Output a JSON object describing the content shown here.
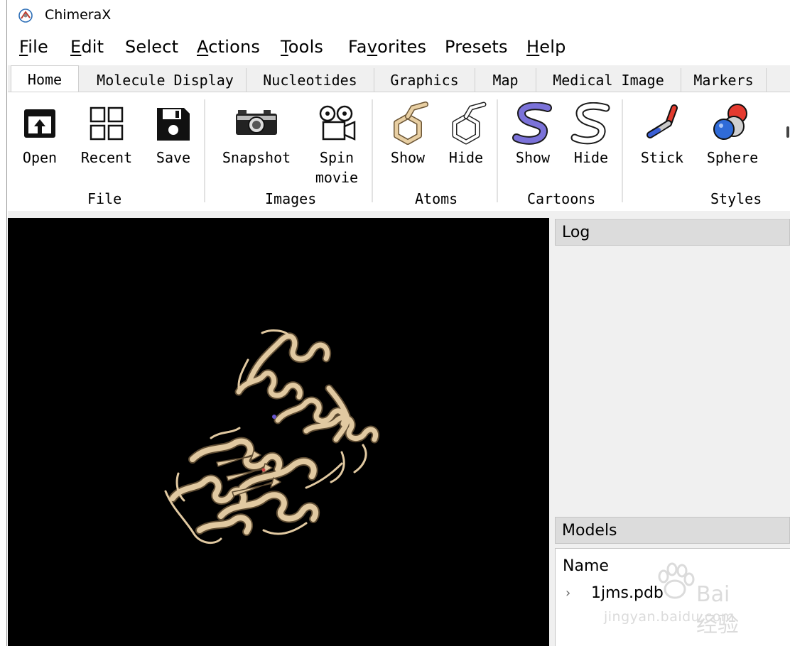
{
  "window": {
    "title": "ChimeraX",
    "icon": "chimerax-app-icon"
  },
  "menubar": {
    "items": [
      {
        "label": "File",
        "underline": "F"
      },
      {
        "label": "Edit",
        "underline": "E"
      },
      {
        "label": "Select",
        "underline": ""
      },
      {
        "label": "Actions",
        "underline": "A"
      },
      {
        "label": "Tools",
        "underline": "T"
      },
      {
        "label": "Favorites",
        "underline": "v"
      },
      {
        "label": "Presets",
        "underline": ""
      },
      {
        "label": "Help",
        "underline": "H"
      }
    ]
  },
  "toolbar": {
    "tabs": [
      "Home",
      "Molecule Display",
      "Nucleotides",
      "Graphics",
      "Map",
      "Medical Image",
      "Markers"
    ],
    "active_tab": "Home",
    "buttons": {
      "open": "Open",
      "recent": "Recent",
      "save": "Save",
      "snapshot": "Snapshot",
      "spin_movie_line1": "Spin",
      "spin_movie_line2": "movie",
      "atoms_show": "Show",
      "atoms_hide": "Hide",
      "cartoons_show": "Show",
      "cartoons_hide": "Hide",
      "stick": "Stick",
      "sphere": "Sphere"
    },
    "groups": {
      "file": "File",
      "images": "Images",
      "atoms": "Atoms",
      "cartoons": "Cartoons",
      "styles": "Styles"
    }
  },
  "colors": {
    "ribbon_protein": "#e1c9a1",
    "cartoon_icon_blue": "#7b72d9",
    "viewer_bg": "#000000"
  },
  "log": {
    "title": "Log"
  },
  "models": {
    "title": "Models",
    "column_name": "Name",
    "rows": [
      {
        "name": "1jms.pdb",
        "expander": "›"
      }
    ]
  },
  "watermark": {
    "brand": "Bai 经验",
    "url": "jingyan.baidu.com"
  }
}
